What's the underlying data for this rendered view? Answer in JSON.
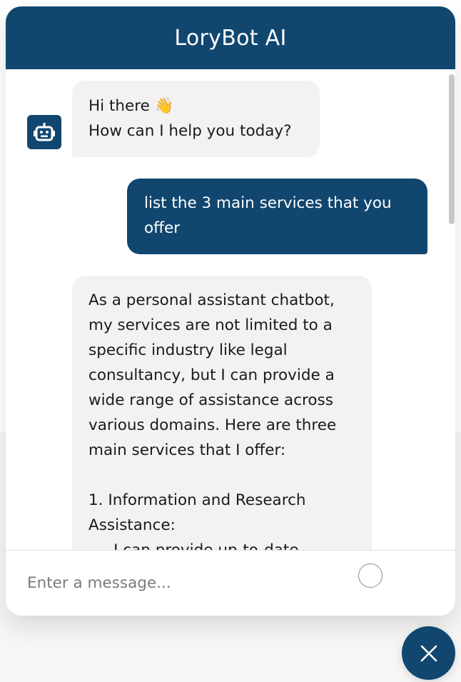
{
  "header": {
    "title": "LoryBot AI"
  },
  "messages": [
    {
      "role": "bot",
      "text": "Hi there 👋\nHow can I help you today?"
    },
    {
      "role": "user",
      "text": "list the 3 main services that you\noffer"
    },
    {
      "role": "bot",
      "text": "As a personal assistant chatbot,\nmy services are not limited to a\nspecific industry like legal\nconsultancy, but I can provide a\nwide range of assistance across\nvarious domains. Here are three\nmain services that I offer:\n\n1. Information and Research\nAssistance:\n   - I can provide up-to-date"
    }
  ],
  "input": {
    "placeholder": "Enter a message..."
  },
  "icons": {
    "avatar": "robot-icon",
    "send": "send-circle-icon",
    "toggle": "close-icon"
  },
  "colors": {
    "brand": "#11476f",
    "bot_bubble": "#f2f2f2"
  }
}
